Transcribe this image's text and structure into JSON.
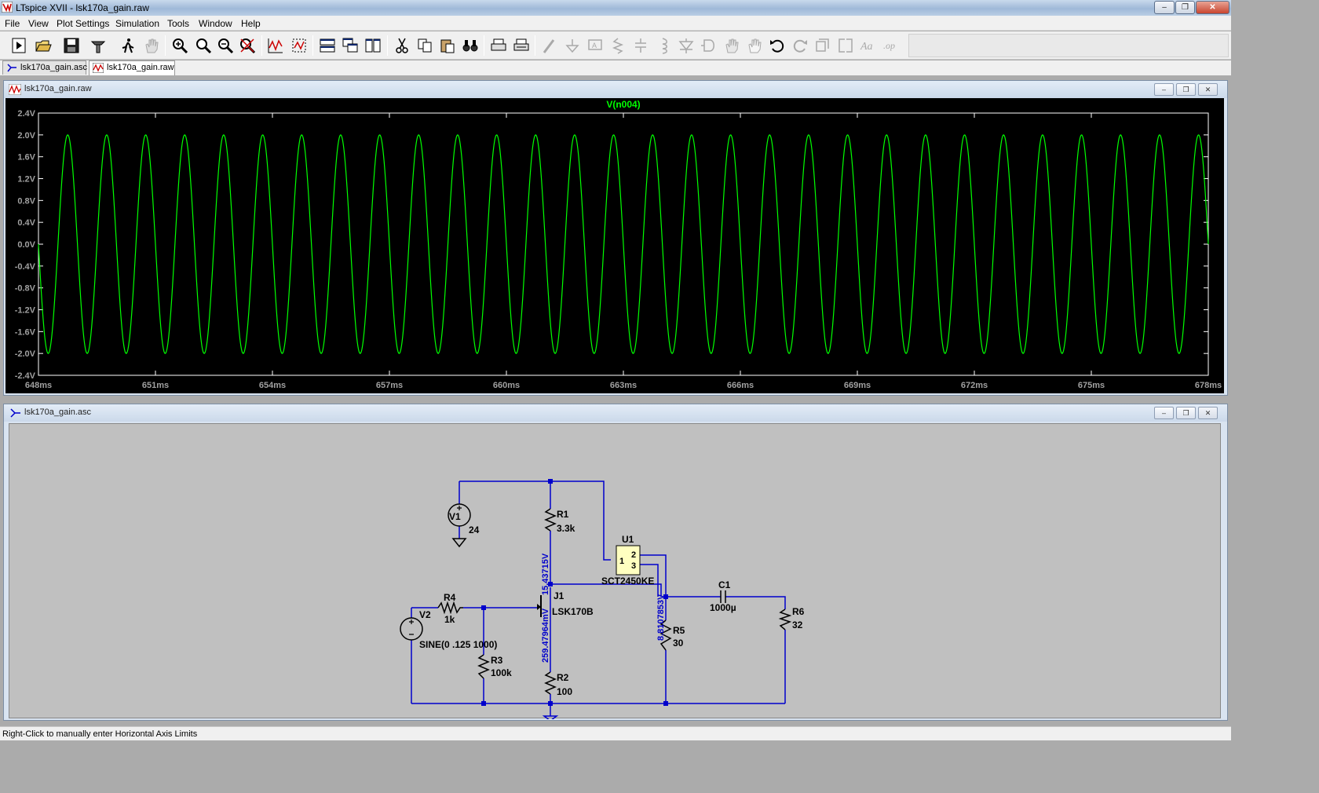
{
  "window": {
    "title": "LTspice XVII - lsk170a_gain.raw",
    "minimize": "–",
    "restore": "❐",
    "close": "✕"
  },
  "menu": [
    "File",
    "View",
    "Plot Settings",
    "Simulation",
    "Tools",
    "Window",
    "Help"
  ],
  "toolbar": {
    "icons": [
      "run-icon",
      "open-icon",
      "save-icon",
      "control-panel-icon",
      "halt-icon",
      "pan-icon",
      "zoom-in-icon",
      "zoom-full-icon",
      "zoom-out-icon",
      "zoom-cancel-icon",
      "autorange-icon",
      "mark-plane-icon",
      "tile-horizontal-icon",
      "cascade-icon",
      "tile-vertical-icon",
      "cut-icon",
      "copy-icon",
      "paste-icon",
      "find-icon",
      "print-icon",
      "print-setup-icon",
      "wire-icon",
      "ground-icon",
      "label-net-icon",
      "resistor-icon",
      "capacitor-icon",
      "inductor-icon",
      "diode-icon",
      "component-icon",
      "move-icon",
      "drag-icon",
      "undo-icon",
      "redo-icon",
      "rotate-icon",
      "mirror-icon",
      "text-icon",
      "spice-directive-icon"
    ]
  },
  "tabs": [
    {
      "label": "lsk170a_gain.asc",
      "icon": "schematic-icon",
      "active": false
    },
    {
      "label": "lsk170a_gain.raw",
      "icon": "waveform-icon",
      "active": true
    }
  ],
  "plot_window": {
    "title": "lsk170a_gain.raw",
    "trace_label": "V(n004)",
    "trace_color": "#00ff00"
  },
  "chart_data": {
    "type": "line",
    "series": [
      {
        "name": "V(n004)",
        "waveform": "sine",
        "amplitude": 2.0,
        "offset": 0.0,
        "frequency_hz": 1000
      }
    ],
    "x_range": [
      648,
      678
    ],
    "x_unit": "ms",
    "ylim": [
      -2.4,
      2.4
    ],
    "y_ticks": [
      "2.4V",
      "2.0V",
      "1.6V",
      "1.2V",
      "0.8V",
      "0.4V",
      "0.0V",
      "-0.4V",
      "-0.8V",
      "-1.2V",
      "-1.6V",
      "-2.0V",
      "-2.4V"
    ],
    "x_ticks": [
      "648ms",
      "651ms",
      "654ms",
      "657ms",
      "660ms",
      "663ms",
      "666ms",
      "669ms",
      "672ms",
      "675ms",
      "678ms"
    ],
    "grid": false,
    "background": "#000000",
    "axis_color": "#ffffff",
    "label_color": "#a0a0a0"
  },
  "schematic_window": {
    "title": "lsk170a_gain.asc",
    "labels": {
      "V1": "V1",
      "V1_value": "24",
      "R1": "R1",
      "R1_value": "3.3k",
      "U1": "U1",
      "U1_part": "SCT2450KE",
      "U1_pin1": "1",
      "U1_pin2": "2",
      "U1_pin3": "3",
      "C1": "C1",
      "C1_value": "1000µ",
      "R4": "R4",
      "R4_value": "1k",
      "V2": "V2",
      "V2_value": "SINE(0 .125 1000)",
      "J1": "J1",
      "J1_part": "LSK170B",
      "R3": "R3",
      "R3_value": "100k",
      "R2": "R2",
      "R2_value": "100",
      "R5": "R5",
      "R5_value": "30",
      "R6": "R6",
      "R6_value": "32",
      "op_drain": "15.43715V",
      "op_source": "259.47964mV",
      "op_out": "8.8107853V"
    },
    "wire_color": "#0000cc",
    "background": "#c0c0c0"
  },
  "status": "Right-Click to manually enter Horizontal Axis Limits"
}
